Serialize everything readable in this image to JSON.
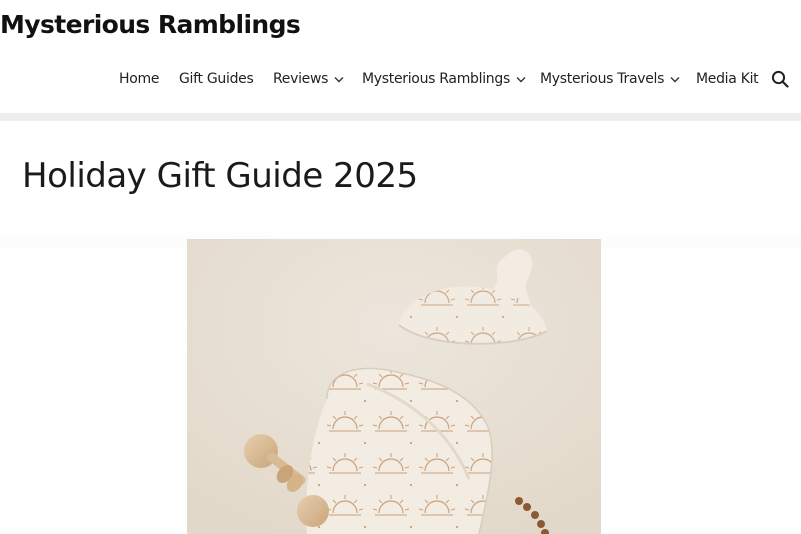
{
  "site": {
    "title": "Mysterious Ramblings"
  },
  "nav": {
    "items": [
      {
        "label": "Home",
        "has_dropdown": false
      },
      {
        "label": "Gift Guides",
        "has_dropdown": false
      },
      {
        "label": "Reviews",
        "has_dropdown": true
      },
      {
        "label": "Mysterious Ramblings",
        "has_dropdown": true
      },
      {
        "label": "Mysterious Travels",
        "has_dropdown": true
      },
      {
        "label": "Media Kit",
        "has_dropdown": false
      }
    ],
    "search_icon": "search-icon",
    "dropdown_icon": "chevron-down-icon"
  },
  "post": {
    "title": "Holiday Gift Guide 2025",
    "featured_image": "baby swaddle with sun print, knotted baby hat and wooden rattle on a beige background"
  },
  "colors": {
    "text": "#111111",
    "divider": "#eeeeee",
    "image_background": "#e9e1d5",
    "fabric": "#f3ece3",
    "print": "#c39267"
  }
}
